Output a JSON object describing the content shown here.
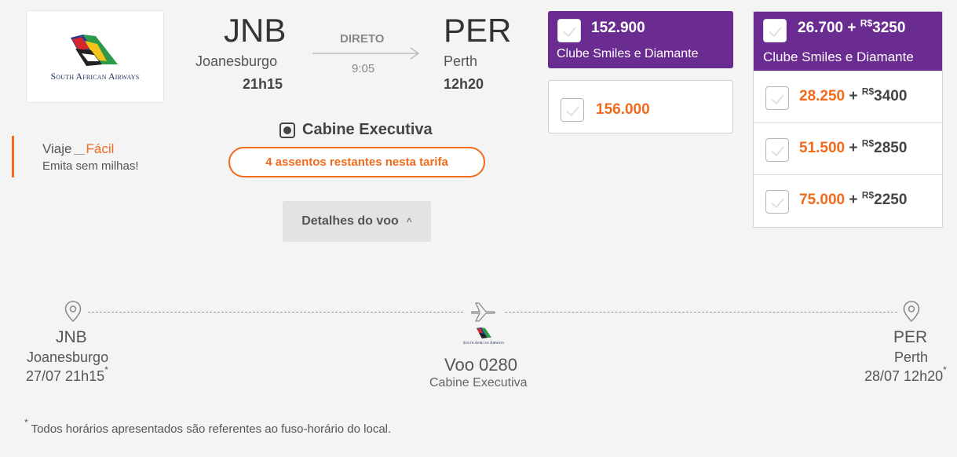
{
  "airline": {
    "name": "South African Airways"
  },
  "promo": {
    "prefix": "Viaje",
    "highlight": "Fácil",
    "subtitle": "Emita sem milhas!"
  },
  "flight": {
    "origin": {
      "code": "JNB",
      "city": "Joanesburgo",
      "time": "21h15"
    },
    "destination": {
      "code": "PER",
      "city": "Perth",
      "time": "12h20"
    },
    "type": "DIRETO",
    "duration": "9:05",
    "cabin": "Cabine Executiva",
    "seats_notice": "4 assentos restantes nesta tarifa",
    "details_label": "Detalhes do voo"
  },
  "fares": {
    "miles_only": [
      {
        "miles": "152.900",
        "tag": "Clube Smiles e Diamante",
        "selected_style": true
      },
      {
        "miles": "156.000"
      }
    ],
    "miles_and_money": {
      "top": {
        "miles": "26.700",
        "plus": "+",
        "currency": "R$",
        "money": "3250",
        "tag": "Clube Smiles e Diamante"
      },
      "rows": [
        {
          "miles": "28.250",
          "plus": "+",
          "currency": "R$",
          "money": "3400"
        },
        {
          "miles": "51.500",
          "plus": "+",
          "currency": "R$",
          "money": "2850"
        },
        {
          "miles": "75.000",
          "plus": "+",
          "currency": "R$",
          "money": "2250"
        }
      ]
    }
  },
  "timeline": {
    "origin": {
      "code": "JNB",
      "city": "Joanesburgo",
      "datetime": "27/07 21h15",
      "mark": "*"
    },
    "flight": {
      "number": "Voo 0280",
      "cabin": "Cabine Executiva",
      "airline_small": "South African Airways"
    },
    "destination": {
      "code": "PER",
      "city": "Perth",
      "datetime": "28/07 12h20",
      "mark": "*"
    }
  },
  "footnote": {
    "mark": "*",
    "text": " Todos horários apresentados são referentes ao fuso-horário do local."
  },
  "colors": {
    "accent": "#f26a1b",
    "purple": "#6b2c91",
    "background": "#f4f4f4"
  }
}
